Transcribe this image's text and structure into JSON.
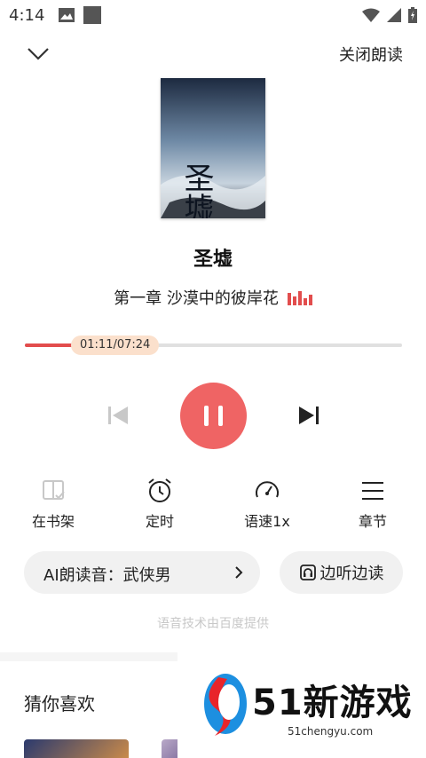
{
  "status_bar": {
    "time": "4:14",
    "icons": [
      "image-icon",
      "square-notification-icon",
      "wifi-icon",
      "cell-signal-icon",
      "battery-icon"
    ]
  },
  "header": {
    "close_reading_label": "关闭朗读",
    "collapse_icon": "chevron-down-icon"
  },
  "book": {
    "title": "圣墟",
    "cover_text": "圣墟",
    "chapter": "第一章 沙漠中的彼岸花"
  },
  "playback": {
    "time_label": "01:11/07:24",
    "progress_fraction": 0.16,
    "state": "playing"
  },
  "functions": [
    {
      "label": "在书架",
      "icon": "bookshelf-icon"
    },
    {
      "label": "定时",
      "icon": "alarm-clock-icon"
    },
    {
      "label": "语速1x",
      "icon": "speedometer-icon"
    },
    {
      "label": "章节",
      "icon": "menu-lines-icon"
    }
  ],
  "voice": {
    "label": "AI朗读音：武侠男",
    "side_read_label": "边听边读"
  },
  "credit": "语音技术由百度提供",
  "recommend": {
    "title": "猜你喜欢"
  },
  "watermark": {
    "text": "51新游戏",
    "domain": "51chengyu.com"
  },
  "colors": {
    "accent": "#ef6464",
    "progress": "#e24d4d",
    "time_badge": "#fbe0cc",
    "pill_bg": "#f1f1f1"
  }
}
